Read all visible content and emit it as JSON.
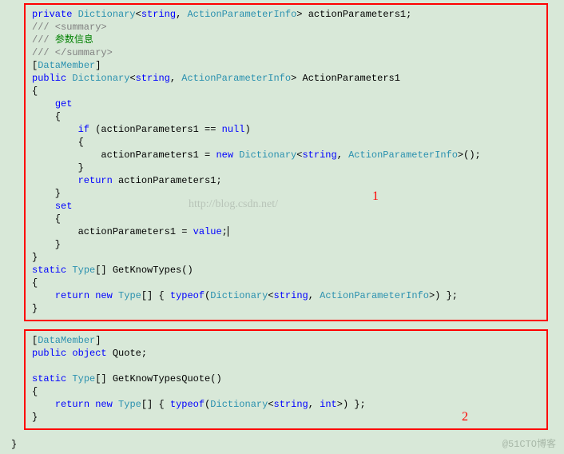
{
  "block1": {
    "l1_kw": "private",
    "l1_type1": "Dictionary",
    "l1_type2": "string",
    "l1_type3": "ActionParameterInfo",
    "l1_rest": "> actionParameters1;",
    "l2": "/// <summary>",
    "l3_prefix": "/// ",
    "l3_text": "参数信息",
    "l4": "/// </summary>",
    "l5_attr": "DataMember",
    "l6_kw": "public",
    "l6_type1": "Dictionary",
    "l6_type2": "string",
    "l6_type3": "ActionParameterInfo",
    "l6_rest": "> ActionParameters1",
    "l7": "{",
    "l8_kw": "get",
    "l9": "    {",
    "l10_kw": "if",
    "l10_mid": " (actionParameters1 == ",
    "l10_null": "null",
    "l10_end": ")",
    "l11": "        {",
    "l12_a": "            actionParameters1 = ",
    "l12_new": "new",
    "l12_sp": " ",
    "l12_t1": "Dictionary",
    "l12_t2": "string",
    "l12_t3": "ActionParameterInfo",
    "l12_end": ">();",
    "l13": "        }",
    "l14_kw": "return",
    "l14_rest": " actionParameters1;",
    "l15": "    }",
    "l16_kw": "set",
    "l17": "    {",
    "l18_a": "        actionParameters1 = ",
    "l18_val": "value",
    "l18_end": ";",
    "l19": "    }",
    "l20": "}",
    "l21_kw": "static",
    "l21_type": "Type",
    "l21_rest": "[] GetKnowTypes()",
    "l22": "{",
    "l23_ret": "return",
    "l23_sp": " ",
    "l23_new": "new",
    "l23_type": "Type",
    "l23_mid": "[] { ",
    "l23_typeof": "typeof",
    "l23_t1": "Dictionary",
    "l23_t2": "string",
    "l23_t3": "ActionParameterInfo",
    "l23_end": ">) };",
    "l24": "}"
  },
  "block2": {
    "l1_attr": "DataMember",
    "l2_kw": "public",
    "l2_obj": "object",
    "l2_rest": " Quote;",
    "l4_kw": "static",
    "l4_type": "Type",
    "l4_rest": "[] GetKnowTypesQuote()",
    "l5": "{",
    "l6_ret": "return",
    "l6_sp": " ",
    "l6_new": "new",
    "l6_type": "Type",
    "l6_mid": "[] { ",
    "l6_typeof": "typeof",
    "l6_t1": "Dictionary",
    "l6_t2": "string",
    "l6_t3": "int",
    "l6_end": ">) };",
    "l7": "}"
  },
  "labels": {
    "n1": "1",
    "n2": "2"
  },
  "closing_brace": "}",
  "watermark": "http://blog.csdn.net/",
  "footer": "@51CTO博客"
}
